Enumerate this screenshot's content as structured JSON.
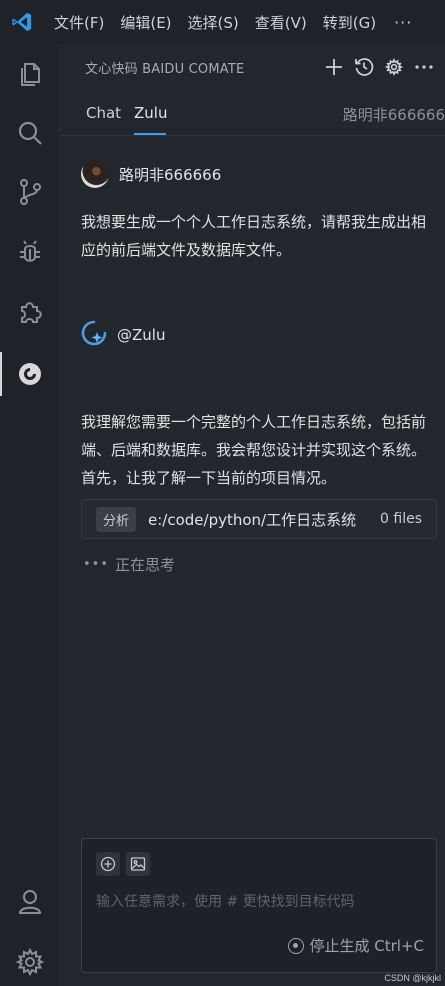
{
  "titlebar": {
    "menu": [
      "文件(F)",
      "编辑(E)",
      "选择(S)",
      "查看(V)",
      "转到(G)"
    ],
    "more": "···"
  },
  "activitybar": {
    "items": [
      {
        "icon": "files-icon"
      },
      {
        "icon": "search-icon"
      },
      {
        "icon": "source-control-icon"
      },
      {
        "icon": "debug-icon"
      },
      {
        "icon": "extensions-icon"
      },
      {
        "icon": "comate-icon",
        "active": true
      },
      {
        "icon": "account-icon"
      },
      {
        "icon": "gear-icon"
      }
    ]
  },
  "panel": {
    "title": "文心快码 BAIDU COMATE",
    "icons": [
      "plus-icon",
      "history-icon",
      "gear-icon",
      "more-icon"
    ]
  },
  "tabs": {
    "items": [
      "Chat",
      "Zulu"
    ],
    "active": "Zulu",
    "user": "路明非666666"
  },
  "chat": {
    "user_name": "路明非666666",
    "user_message": "我想要生成一个个人工作日志系统，请帮我生成出相应的前后端文件及数据库文件。",
    "bot_name": "@Zulu",
    "bot_message": "我理解您需要一个完整的个人工作日志系统，包括前端、后端和数据库。我会帮您设计并实现这个系统。首先，让我了解一下当前的项目情况。",
    "analysis": {
      "badge": "分析",
      "path": "e:/code/python/工作日志系统",
      "count": "0 files"
    },
    "thinking": "正在思考",
    "thinking_dots": "•••"
  },
  "input": {
    "placeholder": "输入任意需求，使用 # 更快找到目标代码",
    "stop_label": "停止生成 Ctrl+C"
  },
  "watermark": "CSDN @kjkjkl",
  "colors": {
    "accent": "#3aa0f0",
    "background": "#1f2229",
    "sidebar": "#22262d"
  }
}
